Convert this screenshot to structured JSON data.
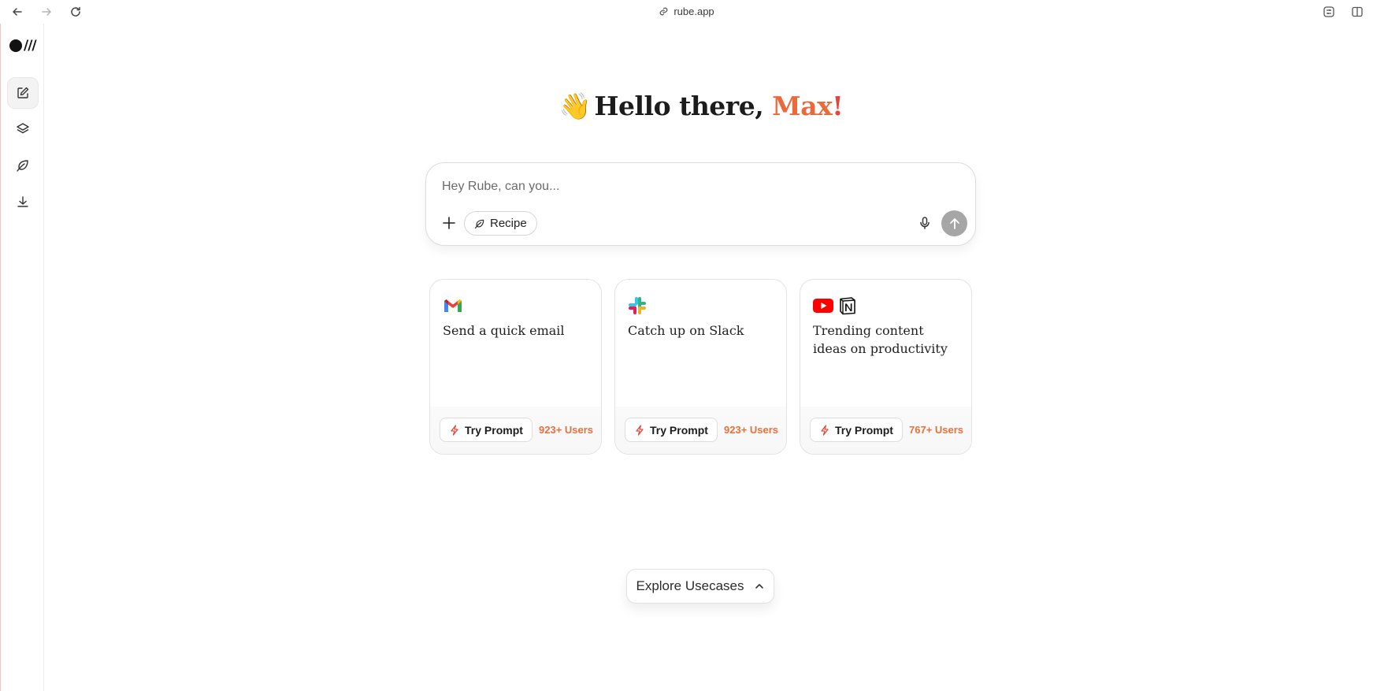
{
  "browser": {
    "url": "rube.app",
    "icons": [
      "back-arrow-icon",
      "forward-arrow-icon",
      "reload-icon",
      "link-icon",
      "extensions-icon",
      "sidebar-toggle-icon"
    ]
  },
  "sidebar": {
    "items": [
      {
        "icon": "new-chat-icon"
      },
      {
        "icon": "layers-icon"
      },
      {
        "icon": "leaf-icon"
      },
      {
        "icon": "download-icon"
      }
    ]
  },
  "greeting": {
    "emoji": "👋",
    "prefix": "Hello there, ",
    "name": "Max",
    "suffix": "!"
  },
  "composer": {
    "placeholder": "Hey Rube, can you...",
    "recipe_label": "Recipe"
  },
  "cards": [
    {
      "title": "Send a quick email",
      "apps": [
        "gmail-icon"
      ],
      "button_label": "Try Prompt",
      "users": "923+ Users"
    },
    {
      "title": "Catch up on Slack",
      "apps": [
        "slack-icon"
      ],
      "button_label": "Try Prompt",
      "users": "923+ Users"
    },
    {
      "title": "Trending content ideas on productivity",
      "apps": [
        "youtube-icon",
        "notion-icon"
      ],
      "button_label": "Try Prompt",
      "users": "767+ Users"
    }
  ],
  "explore": {
    "label": "Explore Usecases"
  },
  "colors": {
    "accent_orange": "#ea6a3c",
    "accent_red": "#e4433e",
    "users_text": "#e8703d",
    "send_button": "#a6a6a6"
  }
}
